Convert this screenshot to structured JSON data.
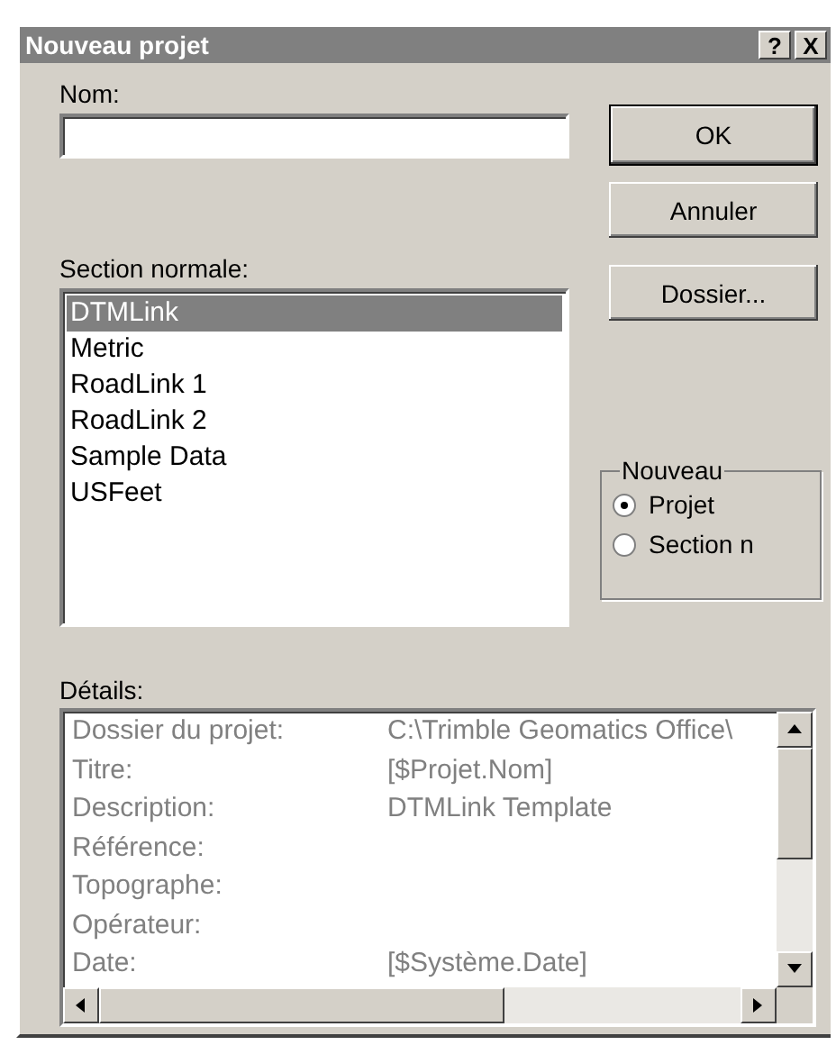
{
  "window": {
    "title": "Nouveau projet",
    "help": "?",
    "close": "X"
  },
  "name_field": {
    "label": "Nom:"
  },
  "section_list": {
    "label": "Section normale:",
    "items": [
      {
        "text": "DTMLink",
        "selected": true
      },
      {
        "text": "Metric",
        "selected": false
      },
      {
        "text": "RoadLink 1",
        "selected": false
      },
      {
        "text": "RoadLink 2",
        "selected": false
      },
      {
        "text": "Sample Data",
        "selected": false
      },
      {
        "text": "USFeet",
        "selected": false
      }
    ]
  },
  "buttons": [
    {
      "label": "OK",
      "default": true
    },
    {
      "label": "Annuler",
      "default": false
    },
    {
      "label": "Dossier...",
      "default": false
    }
  ],
  "new_group": {
    "title": "Nouveau",
    "options": [
      {
        "label": "Projet",
        "selected": true
      },
      {
        "label": "Section n",
        "selected": false
      }
    ]
  },
  "details": {
    "label": "Détails:",
    "disabled": true,
    "rows": [
      {
        "label": "Dossier du projet:",
        "value": "C:\\Trimble Geomatics Office\\"
      },
      {
        "label": "Titre:",
        "value": "[$Projet.Nom]"
      },
      {
        "label": "Description:",
        "value": "DTMLink Template"
      },
      {
        "label": "Référence:"
      },
      {
        "label": "Topographe:"
      },
      {
        "label": "Opérateur:"
      },
      {
        "label": "Date:",
        "value": "[$Système.Date]"
      }
    ]
  }
}
